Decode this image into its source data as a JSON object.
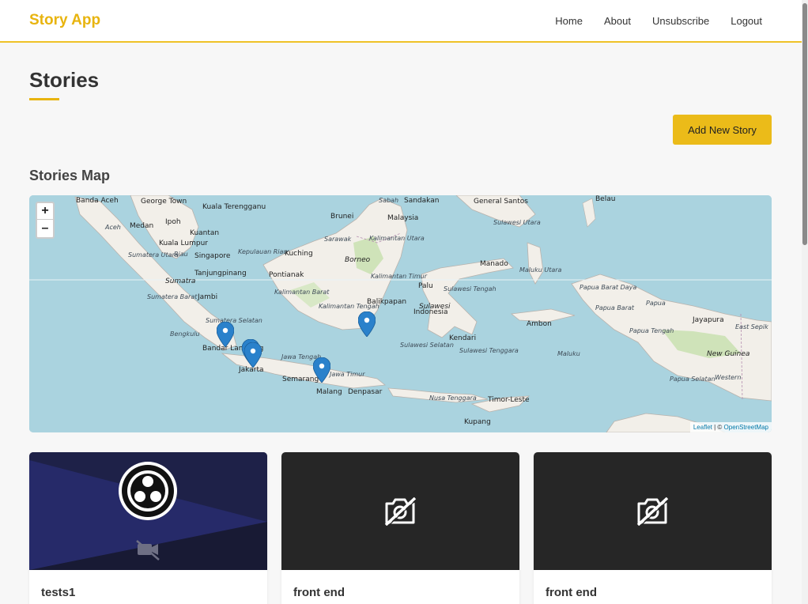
{
  "app": {
    "brand": "Story App"
  },
  "nav": {
    "items": [
      "Home",
      "About",
      "Unsubscribe",
      "Logout"
    ]
  },
  "page": {
    "title": "Stories",
    "add_button": "Add New Story"
  },
  "map": {
    "section_title": "Stories Map",
    "zoom_in": "+",
    "zoom_out": "–",
    "attribution": {
      "leaflet": "Leaflet",
      "sep": " | © ",
      "osm": "OpenStreetMap"
    },
    "labels": {
      "banda_aceh": "Banda Aceh",
      "george_town": "George Town",
      "kuala_terengganu": "Kuala Terengganu",
      "aceh": "Aceh",
      "medan": "Medan",
      "ipoh": "Ipoh",
      "kuantan": "Kuantan",
      "kuala_lumpur": "Kuala Lumpur",
      "riau": "Riau",
      "singapore": "Singapore",
      "kep_riau": "Kepulauan Riau",
      "tanjungpinang": "Tanjungpinang",
      "sumatra": "Sumatra",
      "jambi": "Jambi",
      "sumatera_utara": "Sumatera Utara",
      "sumatera_barat": "Sumatera Barat",
      "sumatera_selatan": "Sumatera Selatan",
      "bengkulu": "Bengkulu",
      "bandar_lampung": "Bandar Lampung",
      "jakarta": "Jakarta",
      "jawa_tengah": "Jawa Tengah",
      "semarang": "Semarang",
      "jawa_timur": "Jawa Timur",
      "malang": "Malang",
      "denpasar": "Denpasar",
      "nusa_tenggara": "Nusa Tenggara",
      "timor_leste": "Timor-Leste",
      "kupang": "Kupang",
      "kuching": "Kuching",
      "pontianak": "Pontianak",
      "kalimantan_barat": "Kalimantan Barat",
      "borneo": "Borneo",
      "kalimantan_tengah": "Kalimantan Tengah",
      "kalimantan_utara": "Kalimantan Utara",
      "kalimantan_timur": "Kalimantan Timur",
      "balikpapan": "Balikpapan",
      "brunei": "Brunei",
      "sabah": "Sabah",
      "sarawak": "Sarawak",
      "sandakan": "Sandakan",
      "malaysia": "Malaysia",
      "general_santos": "General Santos",
      "belau": "Belau",
      "sulawesi_utara": "Sulawesi Utara",
      "manado": "Manado",
      "palu": "Palu",
      "sulawesi": "Sulawesi",
      "indonesia": "Indonesia",
      "sulawesi_tengah": "Sulawesi Tengah",
      "sulawesi_selatan": "Sulawesi Selatan",
      "sulawesi_tenggara": "Sulawesi Tenggara",
      "kendari": "Kendari",
      "maluku_utara": "Maluku Utara",
      "ambon": "Ambon",
      "maluku": "Maluku",
      "papua_barat_daya": "Papua Barat Daya",
      "papua_barat": "Papua Barat",
      "papua": "Papua",
      "papua_tengah": "Papua Tengah",
      "jayapura": "Jayapura",
      "east_sepik": "East Sepik",
      "new_guinea": "New Guinea",
      "papua_selatan": "Papua Selatan",
      "western": "Western"
    }
  },
  "stories": [
    {
      "title": "tests1",
      "media": "video-thumbnail"
    },
    {
      "title": "front end",
      "media": "no-image"
    },
    {
      "title": "front end",
      "media": "no-image"
    }
  ],
  "colors": {
    "accent": "#e8b40f",
    "button": "#ebbb19",
    "marker": "#2a81cb",
    "water": "#aad3df",
    "land": "#f2efe9"
  },
  "icons": [
    "camera-off-icon",
    "video-off-icon",
    "map-marker-icon"
  ]
}
